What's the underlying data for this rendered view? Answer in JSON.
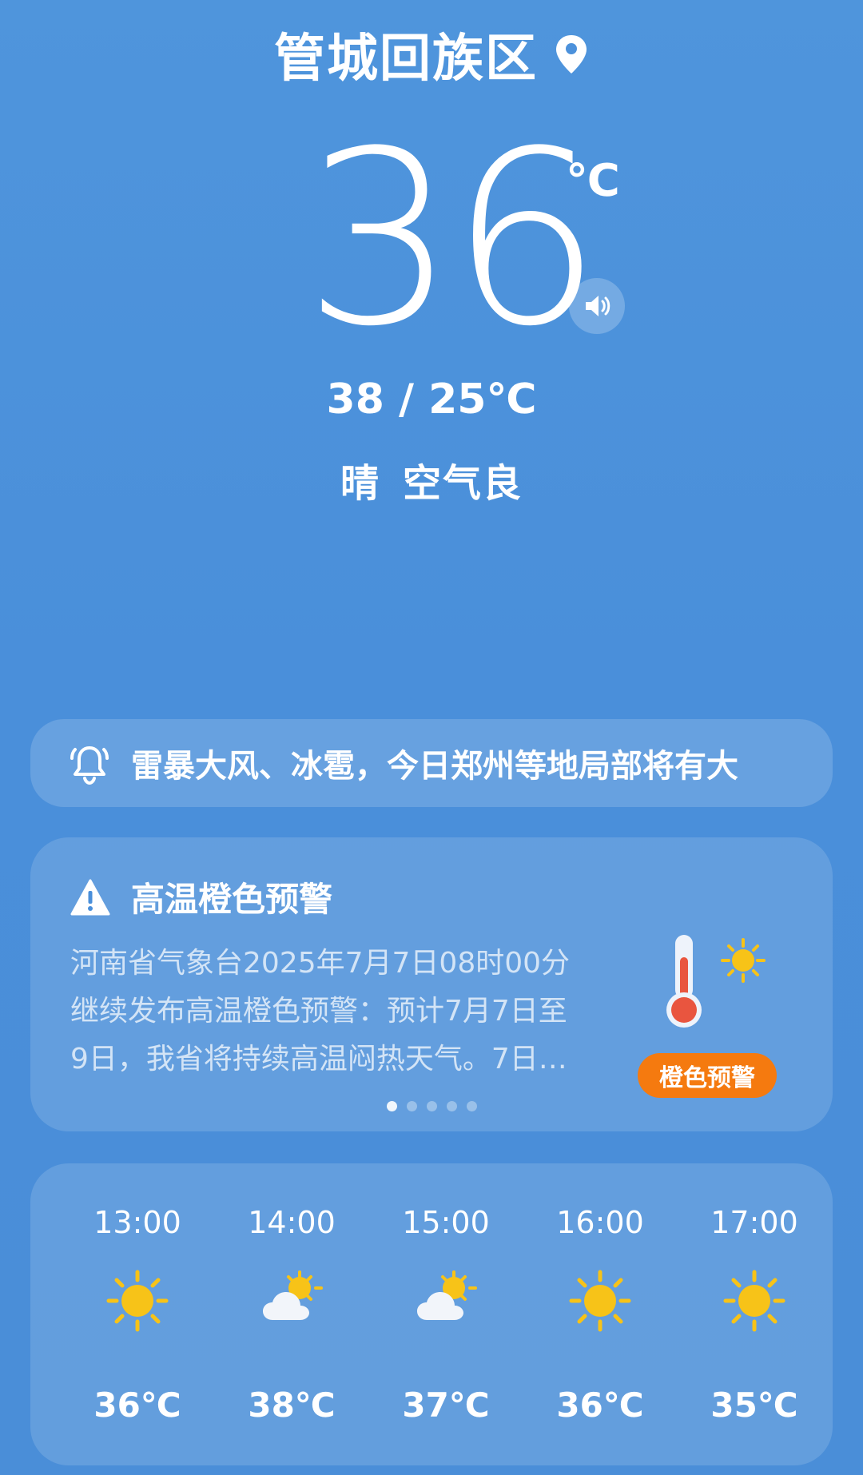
{
  "location": {
    "name": "管城回族区",
    "icon": "location-pin-icon"
  },
  "current": {
    "temperature": "36",
    "unit": "℃",
    "range": "38 / 25℃",
    "weather": "晴",
    "air_quality": "空气良",
    "sound_icon": "speaker-icon"
  },
  "alert_ticker": {
    "icon": "bell-icon",
    "text": "雷暴大风、冰雹，今日郑州等地局部将有大"
  },
  "warning": {
    "icon": "warning-triangle-icon",
    "title": "高温橙色预警",
    "body_lines": [
      "河南省气象台2025年7月7日08时00分",
      "继续发布高温橙色预警：预计7月7日至",
      "9日，我省将持续高温闷热天气。7日…"
    ],
    "badge": "橙色预警",
    "illustration": "thermometer-sun-icon",
    "page_count": 5,
    "active_page": 1
  },
  "hourly": [
    {
      "time": "13:00",
      "icon": "sunny-icon",
      "temp": "36℃"
    },
    {
      "time": "14:00",
      "icon": "partly-cloudy-icon",
      "temp": "38℃"
    },
    {
      "time": "15:00",
      "icon": "partly-cloudy-icon",
      "temp": "37℃"
    },
    {
      "time": "16:00",
      "icon": "sunny-icon",
      "temp": "36℃"
    },
    {
      "time": "17:00",
      "icon": "sunny-icon",
      "temp": "35℃"
    }
  ],
  "colors": {
    "background": "#4a8fda",
    "warning_badge": "#f57a0f",
    "sun": "#f7c318"
  }
}
